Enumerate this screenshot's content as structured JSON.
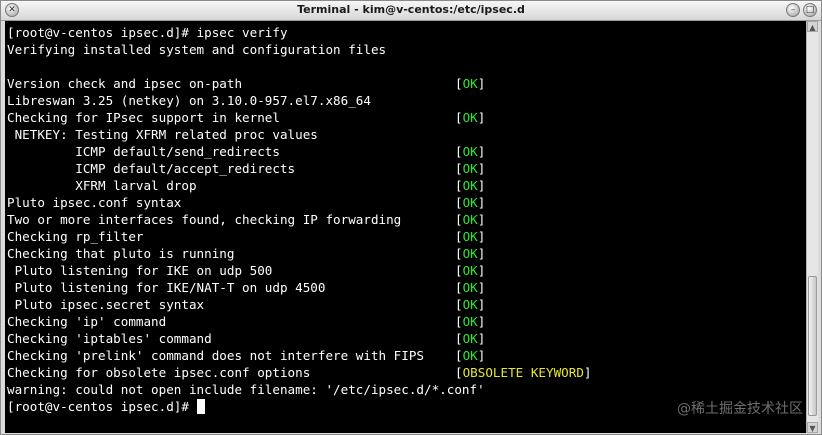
{
  "window": {
    "title": "Terminal - kim@v-centos:/etc/ipsec.d"
  },
  "colors": {
    "background": "#000000",
    "text": "#ffffff",
    "ok": "#2ee62e",
    "warning": "#e6e62e"
  },
  "terminal": {
    "lines": [
      {
        "text": "[root@v-centos ipsec.d]# ipsec verify",
        "status": ""
      },
      {
        "text": "Verifying installed system and configuration files",
        "status": ""
      },
      {
        "text": "",
        "status": ""
      },
      {
        "text": "Version check and ipsec on-path",
        "status": "OK"
      },
      {
        "text": "Libreswan 3.25 (netkey) on 3.10.0-957.el7.x86_64",
        "status": ""
      },
      {
        "text": "Checking for IPsec support in kernel",
        "status": "OK"
      },
      {
        "text": " NETKEY: Testing XFRM related proc values",
        "status": ""
      },
      {
        "text": "         ICMP default/send_redirects",
        "status": "OK"
      },
      {
        "text": "         ICMP default/accept_redirects",
        "status": "OK"
      },
      {
        "text": "         XFRM larval drop",
        "status": "OK"
      },
      {
        "text": "Pluto ipsec.conf syntax",
        "status": "OK"
      },
      {
        "text": "Two or more interfaces found, checking IP forwarding",
        "status": "OK"
      },
      {
        "text": "Checking rp_filter",
        "status": "OK"
      },
      {
        "text": "Checking that pluto is running",
        "status": "OK"
      },
      {
        "text": " Pluto listening for IKE on udp 500",
        "status": "OK"
      },
      {
        "text": " Pluto listening for IKE/NAT-T on udp 4500",
        "status": "OK"
      },
      {
        "text": " Pluto ipsec.secret syntax",
        "status": "OK"
      },
      {
        "text": "Checking 'ip' command",
        "status": "OK"
      },
      {
        "text": "Checking 'iptables' command",
        "status": "OK"
      },
      {
        "text": "Checking 'prelink' command does not interfere with FIPS",
        "status": "OK"
      },
      {
        "text": "Checking for obsolete ipsec.conf options",
        "status": "OBSOLETE KEYWORD"
      },
      {
        "text": "warning: could not open include filename: '/etc/ipsec.d/*.conf'",
        "status": ""
      },
      {
        "text": "[root@v-centos ipsec.d]# ",
        "status": ""
      }
    ]
  },
  "watermark": "@稀土掘金技术社区",
  "icons": {
    "close": "close-icon",
    "minimize": "minimize-icon",
    "maximize": "maximize-icon"
  }
}
